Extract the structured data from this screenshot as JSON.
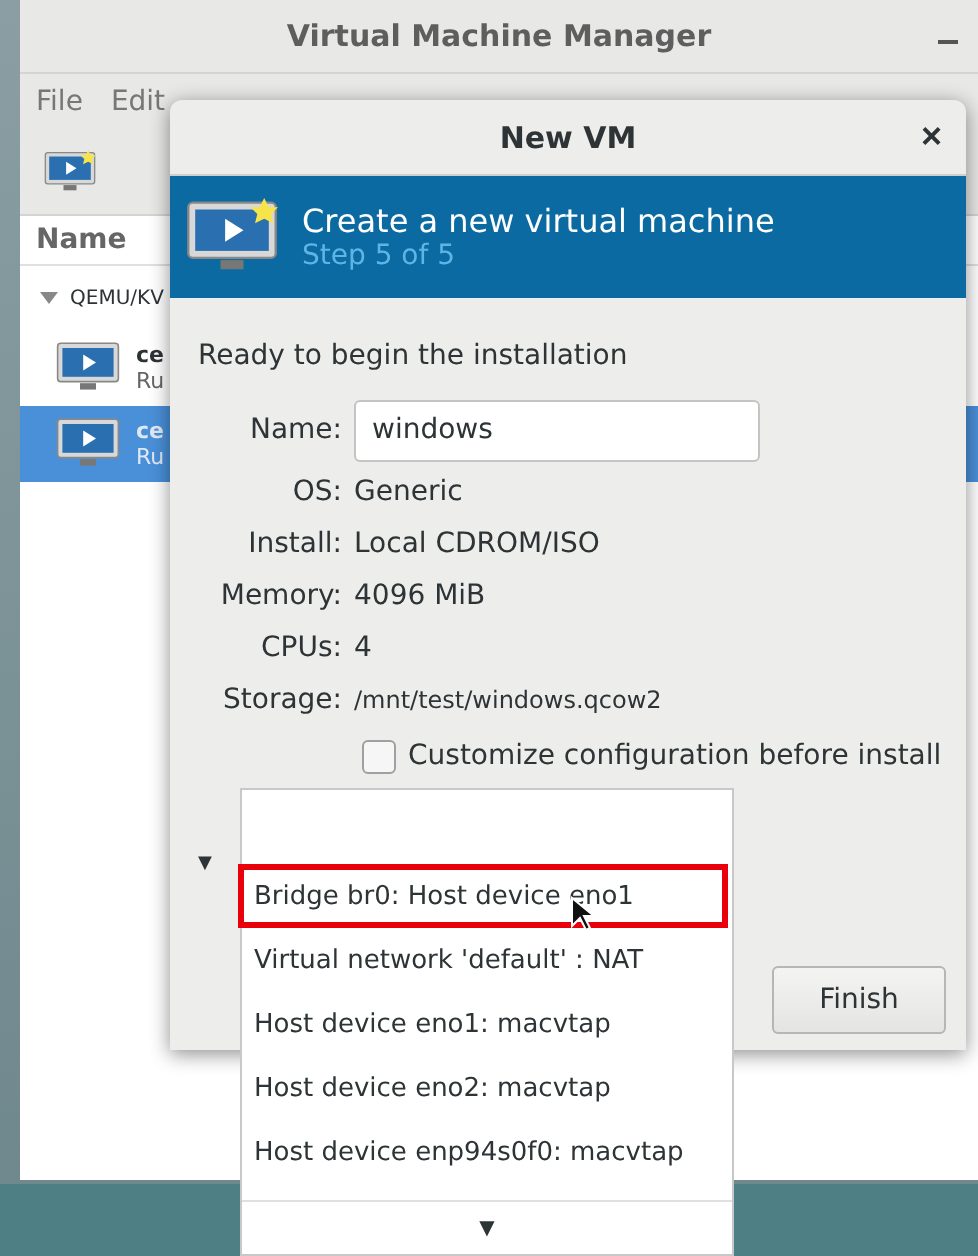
{
  "main_window": {
    "title": "Virtual Machine Manager",
    "menu": [
      "File",
      "Edit"
    ],
    "list_header": "Name",
    "connection": "QEMU/KV",
    "vms": [
      {
        "name": "ce",
        "status": "Ru",
        "selected": false
      },
      {
        "name": "ce",
        "status": "Ru",
        "selected": true
      }
    ]
  },
  "dialog": {
    "title": "New VM",
    "close": "×",
    "heading": "Create a new virtual machine",
    "step": "Step 5 of 5",
    "intro": "Ready to begin the installation",
    "name_label": "Name:",
    "name_value": "windows",
    "details": [
      {
        "label": "OS:",
        "value": "Generic",
        "kind": "normal"
      },
      {
        "label": "Install:",
        "value": "Local CDROM/ISO",
        "kind": "normal"
      },
      {
        "label": "Memory:",
        "value": "4096 MiB",
        "kind": "normal"
      },
      {
        "label": "CPUs:",
        "value": "4",
        "kind": "normal"
      },
      {
        "label": "Storage:",
        "value": "/mnt/test/windows.qcow2",
        "kind": "small"
      }
    ],
    "customize": {
      "label": "Customize configuration before install",
      "checked": false
    },
    "expander": "▼",
    "finish": "Finish"
  },
  "network_menu": {
    "items": [
      {
        "label": "Bridge br0: Host device eno1",
        "highlighted": true
      },
      {
        "label": "Virtual network 'default' : NAT",
        "highlighted": false
      },
      {
        "label": "Host device eno1: macvtap",
        "highlighted": false
      },
      {
        "label": "Host device eno2: macvtap",
        "highlighted": false
      },
      {
        "label": "Host device enp94s0f0: macvtap",
        "highlighted": false
      }
    ],
    "scroll_arrow": "▼"
  }
}
